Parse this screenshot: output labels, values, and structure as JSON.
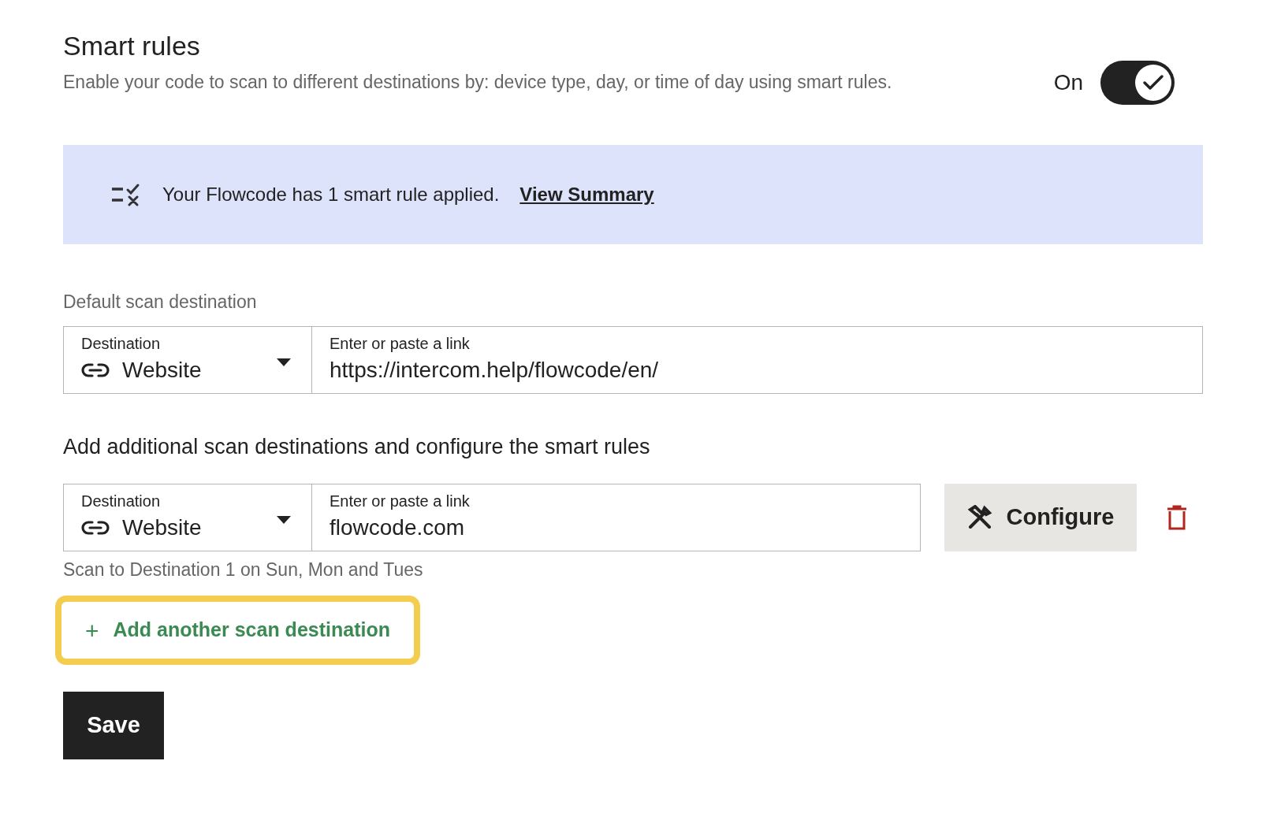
{
  "header": {
    "title": "Smart rules",
    "description": "Enable your code to scan to different destinations by: device type, day, or time of day using smart rules.",
    "toggle": {
      "label": "On",
      "on": true
    }
  },
  "banner": {
    "text": "Your Flowcode has 1 smart rule applied.",
    "link": "View Summary"
  },
  "default_destination": {
    "label": "Default scan destination",
    "destination": {
      "label": "Destination",
      "value": "Website"
    },
    "link": {
      "label": "Enter or paste a link",
      "value": "https://intercom.help/flowcode/en/"
    }
  },
  "additional": {
    "heading": "Add additional scan destinations and configure the smart rules",
    "rules": [
      {
        "destination": {
          "label": "Destination",
          "value": "Website"
        },
        "link": {
          "label": "Enter or paste a link",
          "value": "flowcode.com"
        },
        "configure": "Configure",
        "summary": "Scan to Destination 1 on Sun, Mon and Tues"
      }
    ],
    "add_button": {
      "label": "Add another scan destination",
      "icon": "+",
      "highlighted": true
    }
  },
  "save_button": "Save"
}
